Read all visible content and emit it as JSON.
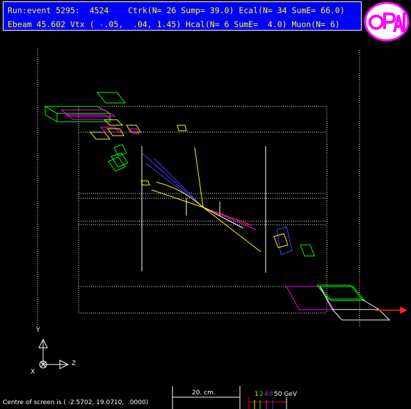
{
  "header": {
    "line1": "Run:event 5295:  4524    Ctrk(N= 26 Sump= 39.0) Ecal(N= 34 SumE= 66.0)",
    "line2": "Ebeam 45.602 Vtx ( -.05,  .04, 1.45) Hcal(N= 6 SumE=  4.0) Muon(N= 6)"
  },
  "logo": {
    "text": "OPAL",
    "color": "#ff00ff"
  },
  "axes": {
    "y": "Y",
    "x": "X",
    "z": "Z"
  },
  "footer": {
    "centre": "Centre of screen is ( -2.5702, 19.0710,  .0000)",
    "scale": "20. cm."
  },
  "energy_scale": {
    "items": [
      {
        "label": "1",
        "color": "#ffff00"
      },
      {
        "label": "2",
        "color": "#00ff00"
      },
      {
        "label": "4",
        "color": "#ff00ff"
      },
      {
        "label": "8",
        "color": "#4444ff"
      },
      {
        "label": "50 GeV",
        "color": "#ffffff"
      }
    ]
  },
  "colors": {
    "background": "#000000",
    "header_bg": "#0000ff",
    "header_text": "#ffff00",
    "detector": "#ffffff",
    "ecal": "#00ff00",
    "hcal": "#ff00ff",
    "track": "#ffff00",
    "muon": "#ff0000"
  }
}
